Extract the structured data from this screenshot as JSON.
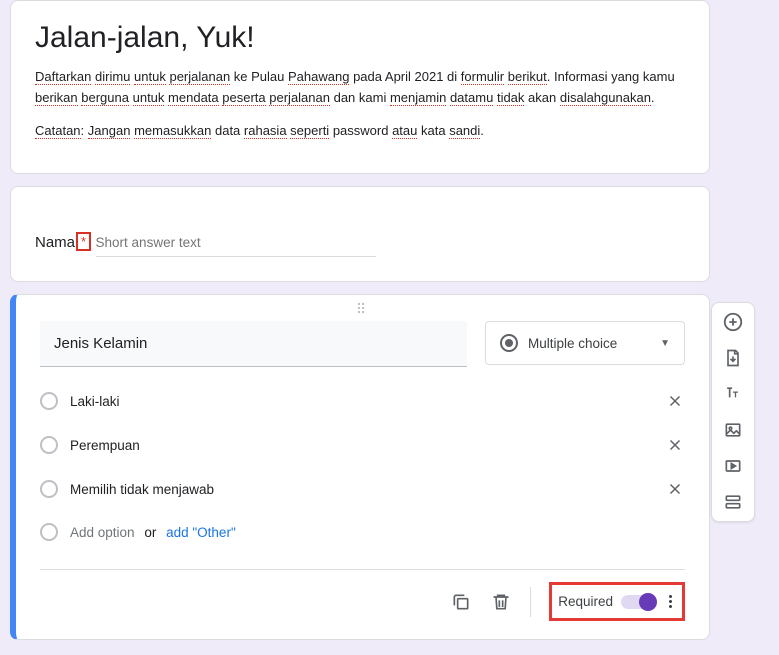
{
  "header": {
    "title": "Jalan-jalan, Yuk!",
    "desc_p1": "Daftarkan dirimu untuk perjalanan ke Pulau Pahawang pada April 2021 di formulir berikut. Informasi yang kamu berikan berguna untuk mendata peserta perjalanan dan kami menjamin datamu tidak akan disalahgunakan.",
    "desc_p2": "Catatan: Jangan memasukkan data rahasia seperti password atau kata sandi."
  },
  "q1": {
    "label": "Nama",
    "required_mark": "*",
    "placeholder": "Short answer text"
  },
  "q2": {
    "label": "Jenis Kelamin",
    "type_label": "Multiple choice",
    "options": {
      "0": "Laki-laki",
      "1": "Perempuan",
      "2": "Memilih tidak menjawab"
    },
    "add_option": "Add option",
    "or_text": "or",
    "add_other": "add \"Other\""
  },
  "footer": {
    "required_label": "Required"
  }
}
